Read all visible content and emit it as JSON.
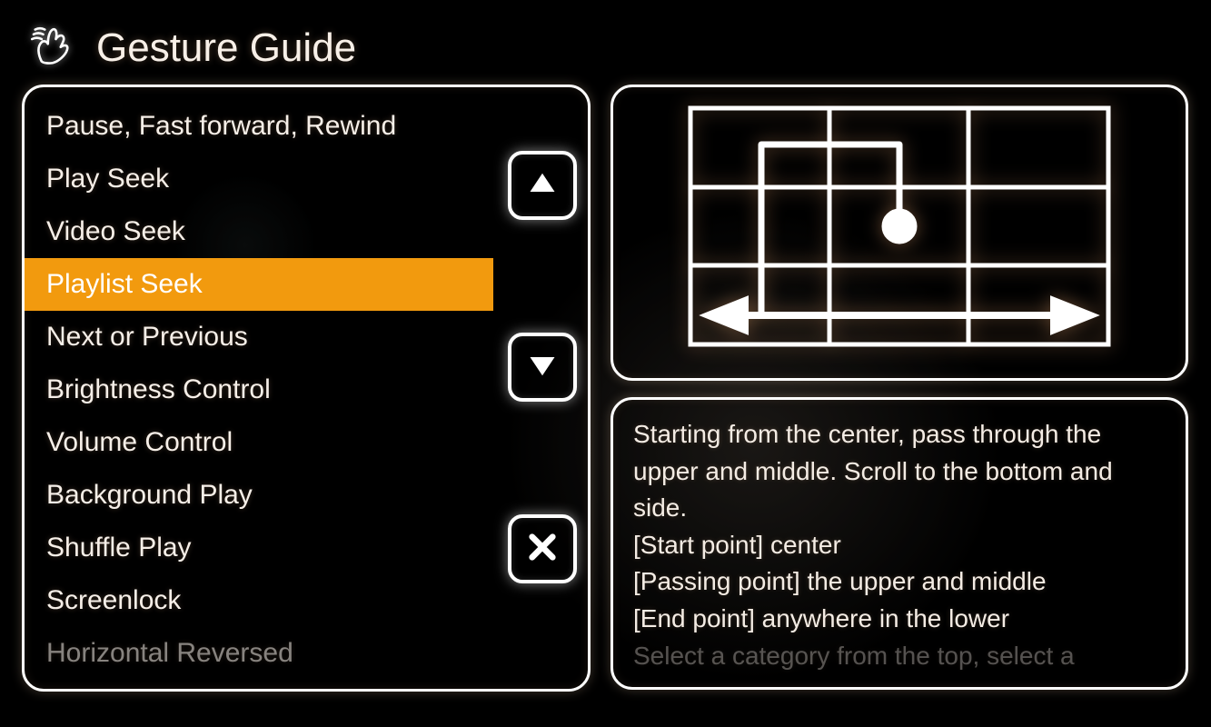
{
  "header": {
    "title": "Gesture Guide"
  },
  "gestures": {
    "items": [
      "Pause, Fast forward, Rewind",
      "Play Seek",
      "Video Seek",
      "Playlist Seek",
      "Next or Previous",
      "Brightness Control",
      "Volume Control",
      "Background Play",
      "Shuffle Play",
      "Screenlock",
      "Horizontal Reversed"
    ],
    "selected_index": 3
  },
  "description": {
    "line1": "Starting from the center, pass through the upper and middle. Scroll to the bottom and side.",
    "line2": "[Start point] center",
    "line3": "[Passing point] the upper and middle",
    "line4": "[End point] anywhere in the lower",
    "line5": "Select a category from the top, select a"
  }
}
